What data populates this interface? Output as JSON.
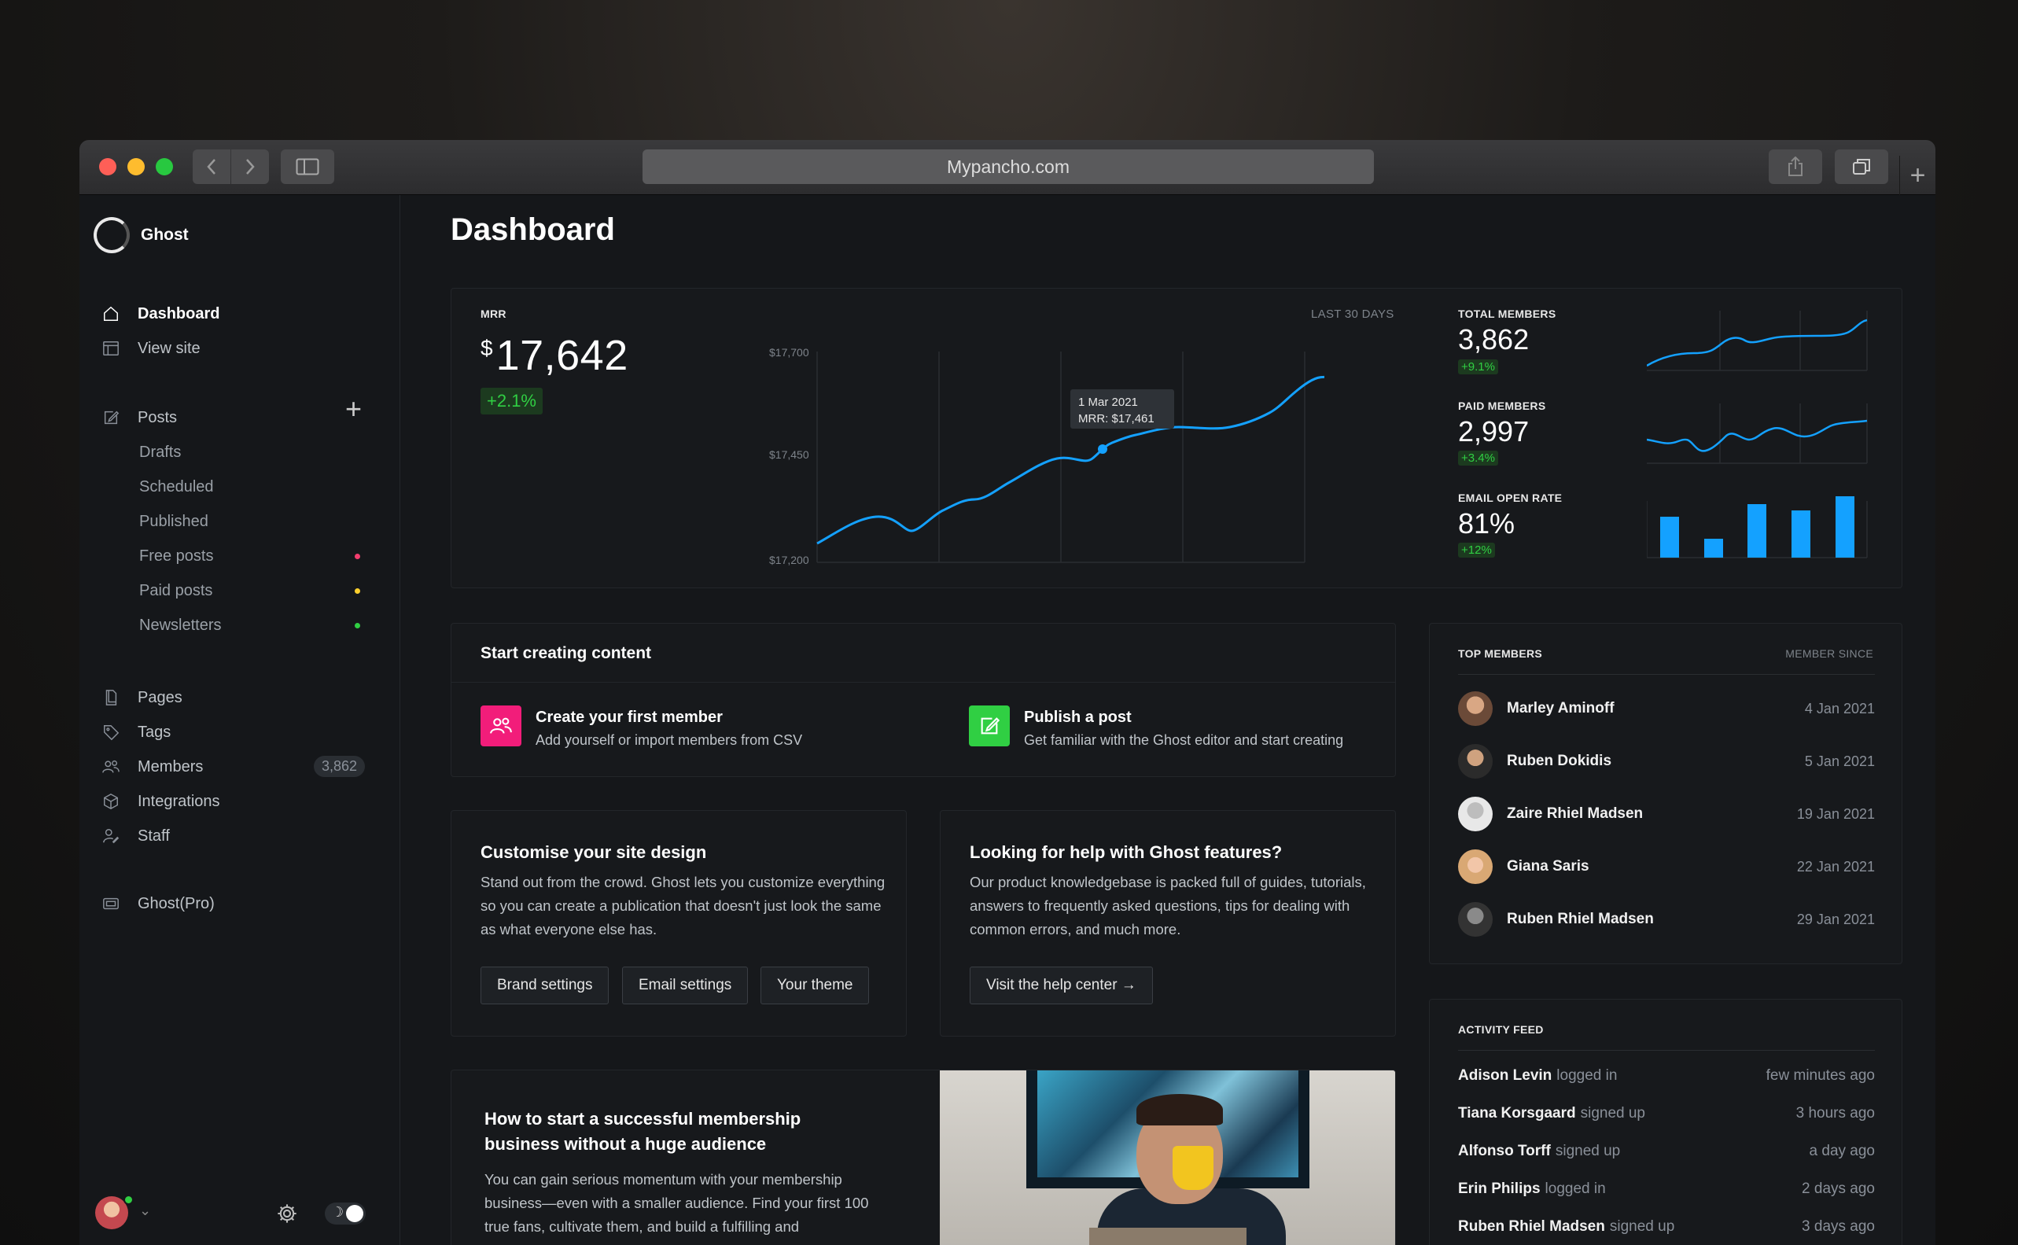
{
  "browser": {
    "url": "Mypancho.com"
  },
  "brand": {
    "name": "Ghost"
  },
  "sidebar": {
    "primary": [
      {
        "label": "Dashboard",
        "icon": "home-icon"
      },
      {
        "label": "View site",
        "icon": "browser-icon"
      }
    ],
    "posts": {
      "label": "Posts",
      "sub": [
        {
          "label": "Drafts"
        },
        {
          "label": "Scheduled"
        },
        {
          "label": "Published"
        },
        {
          "label": "Free posts",
          "dot": "#f23d6e"
        },
        {
          "label": "Paid posts",
          "dot": "#fbcf2d"
        },
        {
          "label": "Newsletters",
          "dot": "#30cf43"
        }
      ]
    },
    "secondary": [
      {
        "label": "Pages",
        "icon": "page-icon"
      },
      {
        "label": "Tags",
        "icon": "tag-icon"
      },
      {
        "label": "Members",
        "icon": "members-icon",
        "count": "3,862"
      },
      {
        "label": "Integrations",
        "icon": "integrations-icon"
      },
      {
        "label": "Staff",
        "icon": "staff-icon"
      }
    ],
    "pro": {
      "label": "Ghost(Pro)",
      "icon": "pro-icon"
    }
  },
  "main": {
    "title": "Dashboard",
    "mrr": {
      "label": "MRR",
      "currency": "$",
      "value": "17,642",
      "change": "+2.1%",
      "range": "LAST 30 DAYS",
      "tooltip_date": "1 Mar 2021",
      "tooltip_value": "MRR: $17,461",
      "y_ticks": [
        "$17,700",
        "$17,450",
        "$17,200"
      ]
    },
    "stats": [
      {
        "label": "TOTAL MEMBERS",
        "value": "3,862",
        "change": "+9.1%"
      },
      {
        "label": "PAID MEMBERS",
        "value": "2,997",
        "change": "+3.4%"
      },
      {
        "label": "EMAIL OPEN RATE",
        "value": "81%",
        "change": "+12%"
      }
    ],
    "start": {
      "title": "Start creating content",
      "items": [
        {
          "title": "Create your first member",
          "desc": "Add yourself or import members from CSV",
          "color": "#f21d7a"
        },
        {
          "title": "Publish a post",
          "desc": "Get familiar with the Ghost editor and start creating",
          "color": "#30cf43"
        }
      ]
    },
    "design": {
      "title": "Customise your site design",
      "body": "Stand out from the crowd. Ghost lets you customize everything so you can create a publication that doesn't just look the same as what everyone else has.",
      "buttons": [
        "Brand settings",
        "Email settings",
        "Your theme"
      ]
    },
    "help": {
      "title": "Looking for help with Ghost features?",
      "body": "Our product knowledgebase is packed full of guides, tutorials, answers to frequently asked questions, tips for dealing with common errors, and much more.",
      "button": "Visit the help center →"
    },
    "article": {
      "title": "How to start a successful membership business without a huge audience",
      "body": "You can gain serious momentum with your membership business—even with a smaller audience. Find your first 100 true fans, cultivate them, and build a fulfilling and"
    },
    "top_members": {
      "title": "TOP MEMBERS",
      "since": "MEMBER SINCE",
      "rows": [
        {
          "name": "Marley Aminoff",
          "date": "4 Jan 2021"
        },
        {
          "name": "Ruben Dokidis",
          "date": "5 Jan 2021"
        },
        {
          "name": "Zaire Rhiel Madsen",
          "date": "19 Jan 2021"
        },
        {
          "name": "Giana Saris",
          "date": "22 Jan 2021"
        },
        {
          "name": "Ruben Rhiel Madsen",
          "date": "29 Jan 2021"
        }
      ]
    },
    "activity": {
      "title": "ACTIVITY FEED",
      "rows": [
        {
          "name": "Adison Levin",
          "verb": "logged in",
          "time": "few minutes ago"
        },
        {
          "name": "Tiana Korsgaard",
          "verb": "signed up",
          "time": "3 hours ago"
        },
        {
          "name": "Alfonso Torff",
          "verb": "signed up",
          "time": "a day ago"
        },
        {
          "name": "Erin Philips",
          "verb": "logged in",
          "time": "2 days ago"
        },
        {
          "name": "Ruben Rhiel Madsen",
          "verb": "signed up",
          "time": "3 days ago"
        }
      ]
    }
  },
  "colors": {
    "accent": "#14a1ff",
    "positive": "#30cf43"
  }
}
